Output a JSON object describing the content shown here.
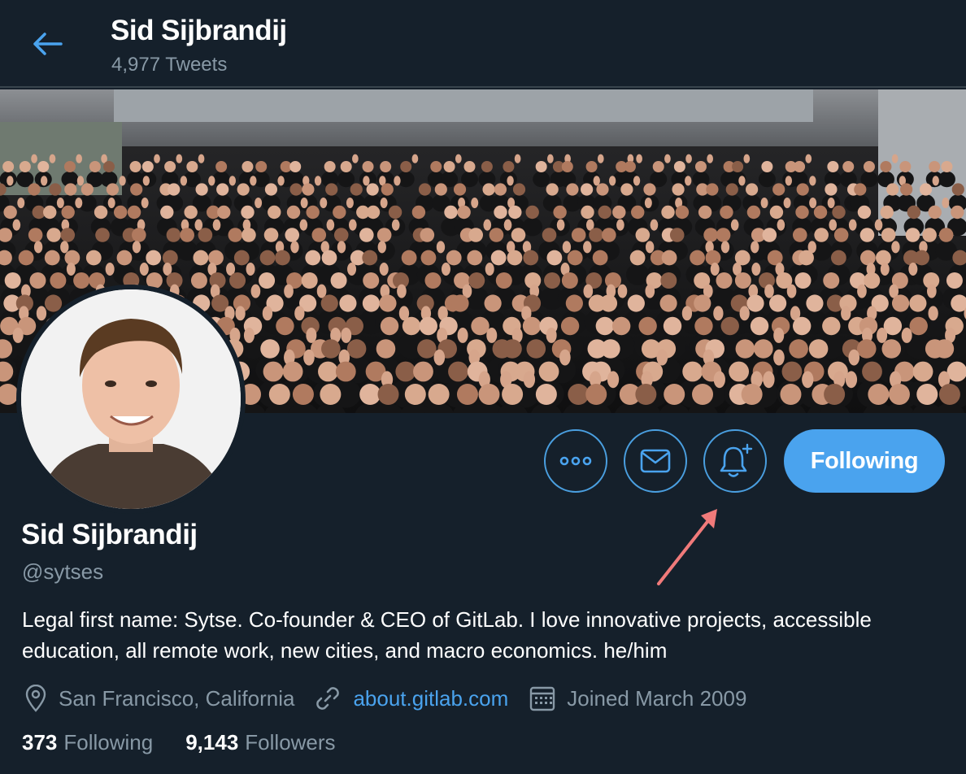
{
  "header": {
    "title": "Sid Sijbrandij",
    "subtitle": "4,977 Tweets"
  },
  "profile": {
    "name": "Sid Sijbrandij",
    "handle": "@sytses",
    "bio": "Legal first name: Sytse. Co-founder & CEO of GitLab. I love innovative projects, accessible education, all remote work, new cities, and macro economics. he/him",
    "location": "San Francisco, California",
    "website": "about.gitlab.com",
    "joined": "Joined March 2009"
  },
  "actions": {
    "more_icon": "more-icon",
    "message_icon": "mail-icon",
    "notify_icon": "bell-plus-icon",
    "follow_label": "Following"
  },
  "stats": {
    "following_count": "373",
    "following_label": "Following",
    "followers_count": "9,143",
    "followers_label": "Followers"
  },
  "colors": {
    "background": "#15202b",
    "accent": "#4aa3ee",
    "muted": "#8899a6",
    "annotation_arrow": "#f07a7a"
  }
}
